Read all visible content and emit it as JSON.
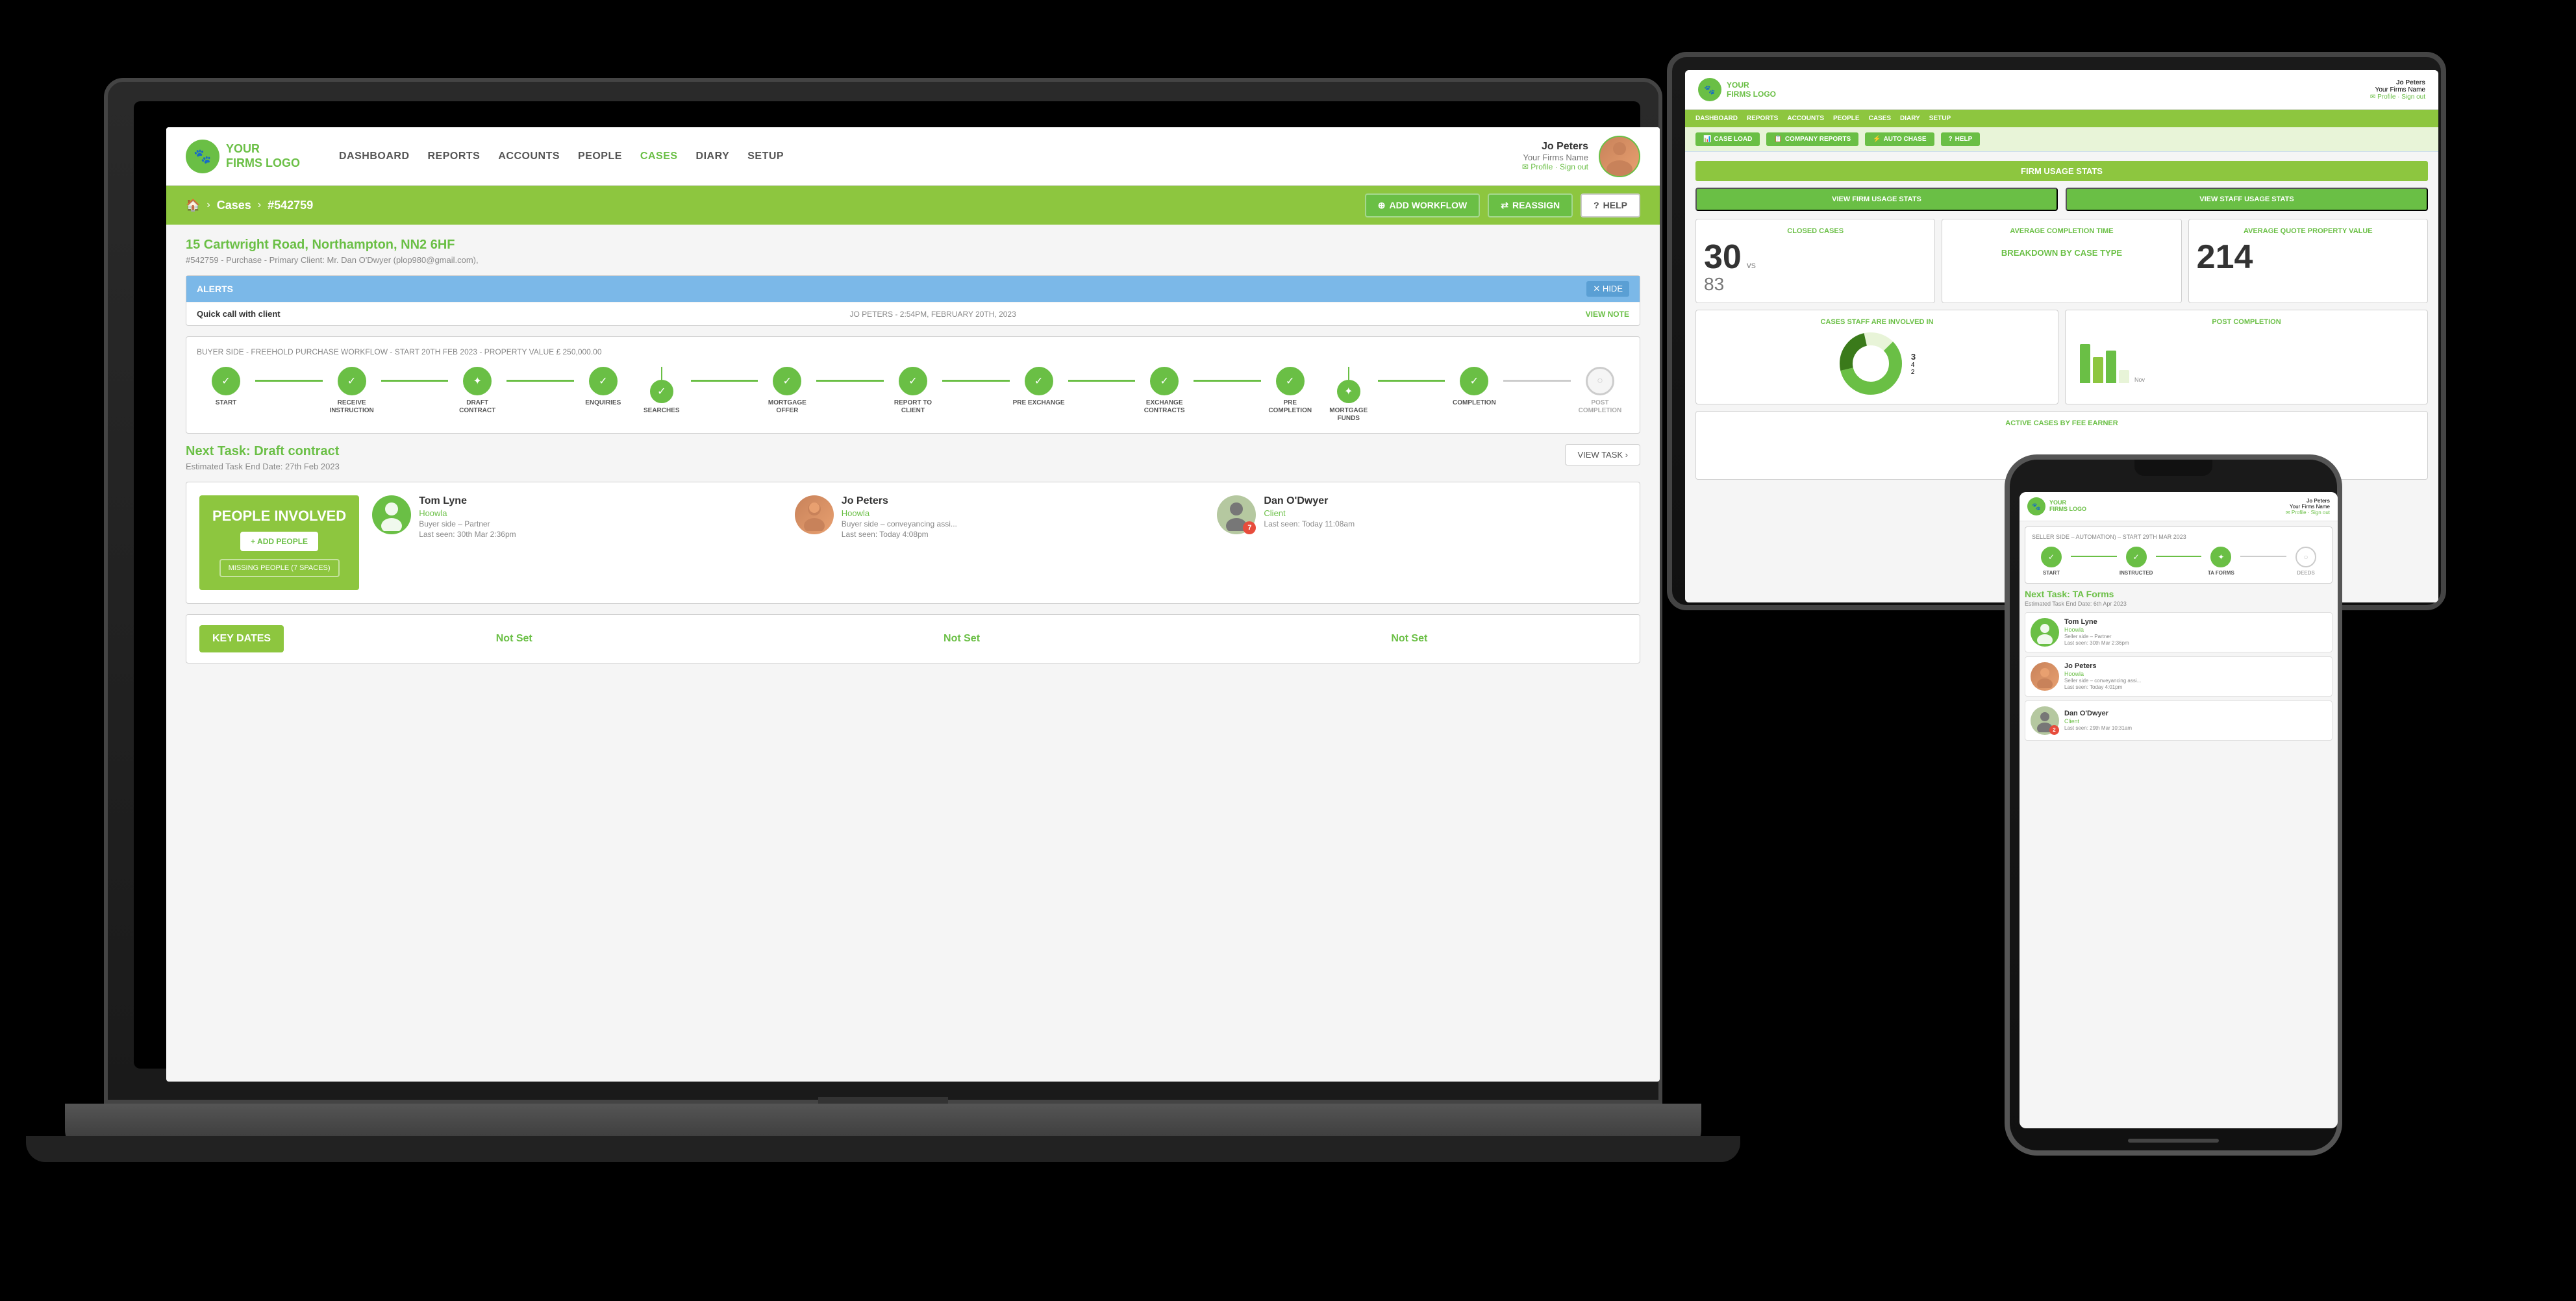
{
  "scene": {
    "background": "#000"
  },
  "laptop": {
    "navbar": {
      "logo_text_line1": "YOUR",
      "logo_text_line2": "FIRMS LOGO",
      "nav_links": [
        "DASHBOARD",
        "REPORTS",
        "ACCOUNTS",
        "PEOPLE",
        "CASES",
        "DIARY",
        "SETUP"
      ],
      "user_name": "Jo Peters",
      "user_firm": "Your Firms Name",
      "user_links": "✉ Profile · Sign out"
    },
    "breadcrumb": {
      "home_icon": "🏠",
      "cases_label": "Cases",
      "case_id": "#542759",
      "add_workflow_label": "ADD WORKFLOW",
      "reassign_label": "REASSIGN",
      "help_label": "HELP"
    },
    "property": {
      "address": "15 Cartwright Road, Northampton, NN2 6HF",
      "ref": "#542759 - Purchase - Primary Client: Mr. Dan O'Dwyer (plop980@gmail.com),"
    },
    "alerts": {
      "header": "ALERTS",
      "hide_label": "✕ HIDE",
      "alert_text": "Quick call with client",
      "alert_meta": "JO PETERS - 2:54PM, FEBRUARY 20TH, 2023",
      "alert_link": "VIEW NOTE"
    },
    "workflow": {
      "title": "BUYER SIDE - FREEHOLD PURCHASE WORKFLOW - START 20TH FEB 2023 - PROPERTY VALUE £ 250,000.00",
      "steps": [
        {
          "label": "START",
          "status": "completed",
          "icon": "●"
        },
        {
          "label": "RECEIVE INSTRUCTION",
          "status": "completed",
          "icon": "●"
        },
        {
          "label": "DRAFT CONTRACT",
          "status": "completed",
          "icon": "●"
        },
        {
          "label": "ENQUIRIES",
          "status": "completed",
          "icon": "●"
        },
        {
          "label": "MORTGAGE OFFER",
          "status": "completed",
          "icon": "●"
        },
        {
          "label": "REPORT TO CLIENT",
          "status": "completed",
          "icon": "●"
        },
        {
          "label": "PRE EXCHANGE",
          "status": "active",
          "icon": "◆"
        },
        {
          "label": "EXCHANGE CONTRACTS",
          "status": "completed",
          "icon": "●"
        },
        {
          "label": "PRE COMPLETION",
          "status": "completed",
          "icon": "●"
        },
        {
          "label": "MORTGAGE FUNDS",
          "status": "active",
          "icon": "◆"
        },
        {
          "label": "COMPLETION",
          "status": "completed",
          "icon": "●"
        },
        {
          "label": "POST COMPLETION",
          "status": "dimmed",
          "icon": "○"
        }
      ]
    },
    "next_task": {
      "label": "Next Task:",
      "title": "Draft contract",
      "date_label": "Estimated Task End Date: 27th Feb 2023",
      "view_task_btn": "VIEW TASK ›"
    },
    "people": {
      "title": "PEOPLE INVOLVED",
      "add_btn": "+ ADD PEOPLE",
      "missing_btn": "MISSING PEOPLE (7 SPACES)",
      "persons": [
        {
          "name": "Tom Lyne",
          "company": "Hoowla",
          "role": "Buyer side – Partner",
          "seen": "Last seen: 30th Mar 2:36pm",
          "avatar_type": "green"
        },
        {
          "name": "Jo Peters",
          "company": "Hoowla",
          "role": "Buyer side – conveyancing assi...",
          "seen": "Last seen: Today 4:08pm",
          "avatar_type": "photo"
        },
        {
          "name": "Dan O'Dwyer",
          "company": "Client",
          "role": "",
          "seen": "Last seen: Today 11:08am",
          "avatar_type": "gray",
          "badge": "7"
        }
      ]
    },
    "key_dates": {
      "label": "KEY DATES",
      "dates": [
        "Not Set",
        "Not Set",
        "Not Set"
      ]
    }
  },
  "tablet": {
    "navbar": {
      "logo_text_line1": "YOUR",
      "logo_text_line2": "FIRMS LOGO",
      "user_name": "Jo Peters",
      "user_firm": "Your Firms Name",
      "user_links": "✉ Profile · Sign out"
    },
    "nav_links": [
      "DASHBOARD",
      "REPORTS",
      "ACCOUNTS",
      "PEOPLE",
      "CASES",
      "DIARY",
      "SETUP"
    ],
    "toolbar_btns": [
      {
        "label": "CASE LOAD",
        "icon": "📊"
      },
      {
        "label": "COMPANY REPORTS",
        "icon": "📋"
      },
      {
        "label": "AUTO CHASE",
        "icon": "⚡"
      },
      {
        "label": "HELP",
        "icon": "?"
      }
    ],
    "section_title": "FIRM USAGE STATS",
    "stats_btns": [
      "VIEW FIRM USAGE STATS",
      "VIEW STAFF USAGE STATS"
    ],
    "metrics": [
      {
        "label": "CLOSED CASES",
        "value": "30",
        "sub": "vs",
        "sub2": "83"
      },
      {
        "label": "AVERAGE COMPLETION TIME"
      },
      {
        "label": "AVERAGE QUOTE PROPERTY VALUE",
        "value": "214"
      }
    ],
    "breakdown_title": "BREAKDOWN BY CASE TYPE",
    "cases_staff_title": "CASES STAFF ARE INVOLVED IN",
    "closed_cases_title": "CLOSED CASES"
  },
  "phone": {
    "navbar": {
      "logo_text_line1": "YOUR",
      "logo_text_line2": "FIRMS LOGO",
      "user_name": "Jo Peters",
      "user_firm": "Your Firms Name",
      "user_links": "✉ Profile · Sign out"
    },
    "workflow": {
      "title": "SELLER SIDE – AUTOMATION) – START 29TH MAR 2023",
      "steps": [
        {
          "label": "START",
          "status": "completed"
        },
        {
          "label": "INSTRUCTED",
          "status": "completed"
        },
        {
          "label": "TA FORMS",
          "status": "active"
        },
        {
          "label": "DEEDS",
          "status": "dimmed"
        }
      ]
    },
    "next_task": {
      "label": "Next Task:",
      "title": "TA Forms",
      "date_label": "Estimated Task End Date: 6th Apr 2023"
    },
    "persons": [
      {
        "name": "Tom Lyne",
        "company": "Hoowla",
        "role": "Seller side – Partner",
        "seen": "Last seen: 30th Mar 2:36pm",
        "avatar_type": "green"
      },
      {
        "name": "Jo Peters",
        "company": "Hoowla",
        "role": "Seller side – conveyancing assi...",
        "seen": "Last seen: Today 4:01pm",
        "avatar_type": "photo"
      },
      {
        "name": "Dan O'Dwyer",
        "company": "Client",
        "role": "",
        "seen": "Last seen: 29th Mar 10:31am",
        "avatar_type": "gray",
        "badge": "2"
      }
    ]
  }
}
